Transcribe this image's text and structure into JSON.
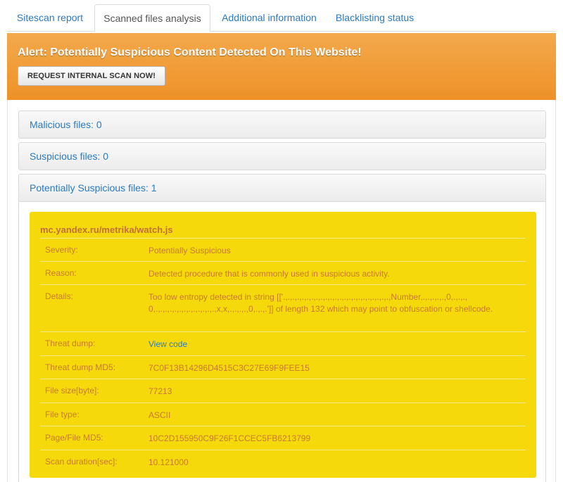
{
  "tabs": [
    {
      "label": "Sitescan report"
    },
    {
      "label": "Scanned files analysis"
    },
    {
      "label": "Additional information"
    },
    {
      "label": "Blacklisting status"
    }
  ],
  "alert": {
    "title": "Alert: Potentially Suspicious Content Detected On This Website!",
    "button": "REQUEST INTERNAL SCAN NOW!"
  },
  "panels": {
    "malicious": "Malicious files: 0",
    "suspicious": "Suspicious files: 0",
    "potential": "Potentially Suspicious files: 1"
  },
  "threat": {
    "file": "mc.yandex.ru/metrika/watch.js",
    "rows": [
      {
        "key": "Severity:",
        "value": "Potentially Suspicious"
      },
      {
        "key": "Reason:",
        "value": "Detected procedure that is commonly used in suspicious activity."
      },
      {
        "key": "Details:",
        "value": "Too low entropy detected in string [['.,.,.,.,.,.,.,.,.,.,.,.,.,.,.,.,.,.,.,.,.,.,.,Number,.,.,.,.,.,0,.,.,.,0,.,.,.,.,.,.,.,.,.,.,.,.,.,x,x,.,.,.,.,0,.,.,.']] of length 132 which may point to obfuscation or shellcode."
      },
      {
        "key": "Threat dump:",
        "value": "View code"
      },
      {
        "key": "Threat dump MD5:",
        "value": "7C0F13B14296D4515C3C27E69F9FEE15"
      },
      {
        "key": "File size[byte]:",
        "value": "77213"
      },
      {
        "key": "File type:",
        "value": "ASCII"
      },
      {
        "key": "Page/File MD5:",
        "value": "10C2D155950C9F26F1CCEC5FB6213799"
      },
      {
        "key": "Scan duration[sec]:",
        "value": "10.121000"
      }
    ]
  }
}
